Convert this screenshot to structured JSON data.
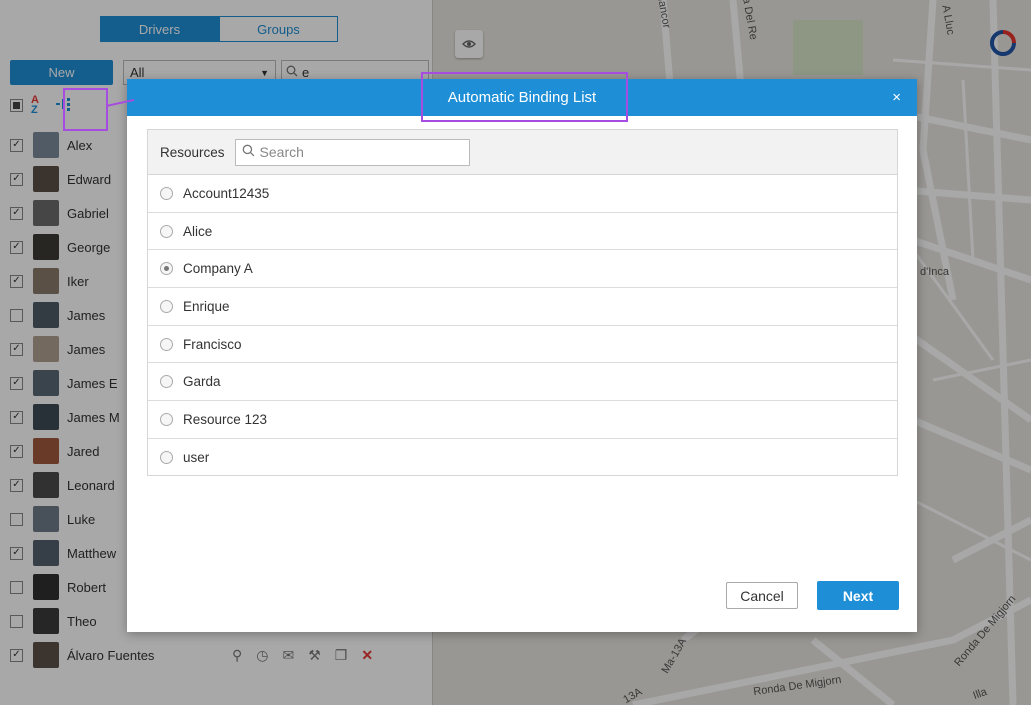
{
  "left_panel": {
    "tabs": [
      {
        "label": "Drivers",
        "active": true
      },
      {
        "label": "Groups",
        "active": false
      }
    ],
    "new_label": "New",
    "filter_value": "All",
    "search_value": "e",
    "sort_icon_label": "A Z",
    "drivers": [
      {
        "name": "Alex",
        "checked": true
      },
      {
        "name": "Edward",
        "checked": true
      },
      {
        "name": "Gabriel",
        "checked": true
      },
      {
        "name": "George",
        "checked": true
      },
      {
        "name": "Iker",
        "checked": true
      },
      {
        "name": "James",
        "checked": false
      },
      {
        "name": "James",
        "checked": true
      },
      {
        "name": "James E",
        "checked": true
      },
      {
        "name": "James M",
        "checked": true
      },
      {
        "name": "Jared",
        "checked": true
      },
      {
        "name": "Leonard",
        "checked": true
      },
      {
        "name": "Luke",
        "checked": false
      },
      {
        "name": "Matthew",
        "checked": true
      },
      {
        "name": "Robert",
        "checked": false
      },
      {
        "name": "Theo",
        "checked": false
      },
      {
        "name": "Álvaro Fuentes",
        "checked": true
      }
    ]
  },
  "map": {
    "labels": [
      "Mancor",
      "Ta Del Re",
      "A Lluc",
      "d'Inca",
      "Ronda De Migjorn",
      "Ronda De Migjorn",
      "Ma-13A",
      "13A",
      "Illa"
    ]
  },
  "modal": {
    "title": "Automatic Binding List",
    "close": "×",
    "resources_label": "Resources",
    "search_placeholder": "Search",
    "items": [
      {
        "label": "Account12435",
        "selected": false
      },
      {
        "label": "Alice",
        "selected": false
      },
      {
        "label": "Company A",
        "selected": true
      },
      {
        "label": "Enrique",
        "selected": false
      },
      {
        "label": "Francisco",
        "selected": false
      },
      {
        "label": "Garda",
        "selected": false
      },
      {
        "label": "Resource 123",
        "selected": false
      },
      {
        "label": "user",
        "selected": false
      }
    ],
    "cancel_label": "Cancel",
    "next_label": "Next"
  },
  "colors": {
    "accent": "#1e8fd6",
    "highlight": "#a64ce0",
    "delete": "#e53935"
  }
}
